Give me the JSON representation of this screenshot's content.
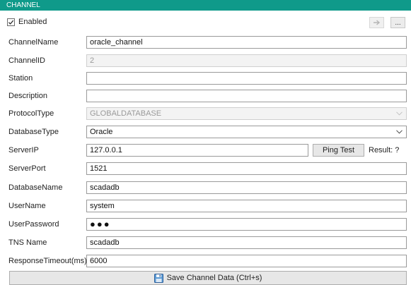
{
  "header": {
    "title": "CHANNEL"
  },
  "enabled": {
    "label": "Enabled",
    "checked": true
  },
  "toolbar": {
    "more_label": "...",
    "arrow_icon": "arrow-icon"
  },
  "fields": {
    "channel_name": {
      "label": "ChannelName",
      "value": "oracle_channel"
    },
    "channel_id": {
      "label": "ChannelID",
      "value": "2"
    },
    "station": {
      "label": "Station",
      "value": ""
    },
    "description": {
      "label": "Description",
      "value": ""
    },
    "protocol_type": {
      "label": "ProtocolType",
      "value": "GLOBALDATABASE"
    },
    "database_type": {
      "label": "DatabaseType",
      "value": "Oracle"
    },
    "server_ip": {
      "label": "ServerIP",
      "value": "127.0.0.1"
    },
    "server_port": {
      "label": "ServerPort",
      "value": "1521"
    },
    "database_name": {
      "label": "DatabaseName",
      "value": "scadadb"
    },
    "user_name": {
      "label": "UserName",
      "value": "system"
    },
    "user_password": {
      "label": "UserPassword",
      "value": "●●●"
    },
    "tns_name": {
      "label": "TNS Name",
      "value": "scadadb"
    },
    "response_timeout": {
      "label": "ResponseTimeout(ms)",
      "value": "6000"
    }
  },
  "ping": {
    "button_label": "Ping Test",
    "result_text": "Result: ?"
  },
  "save": {
    "label": "Save Channel Data (Ctrl+s)",
    "icon": "save-icon"
  },
  "colors": {
    "header_bg": "#0f9a8a",
    "field_border": "#9a9a9a"
  }
}
